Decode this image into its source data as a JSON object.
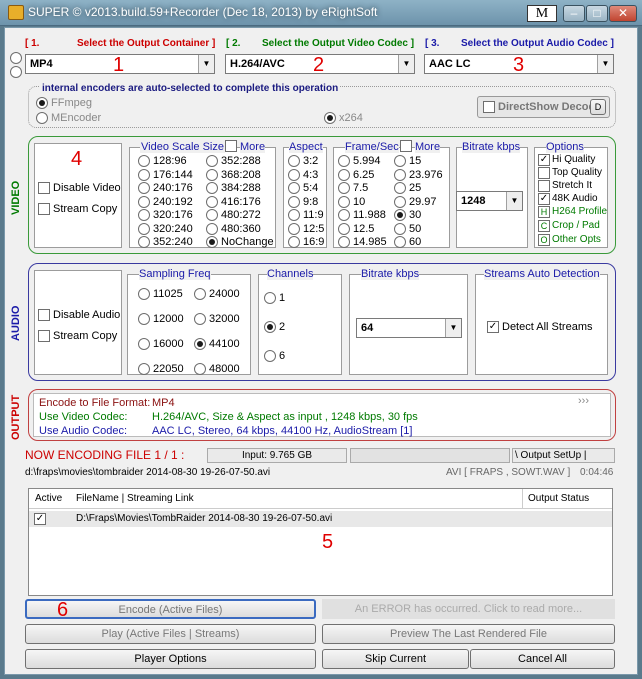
{
  "window": {
    "title": "SUPER © v2013.build.59+Recorder (Dec 18, 2013) by eRightSoft",
    "mode_button": "M",
    "min": "–",
    "max": "□",
    "close": "✕"
  },
  "output": {
    "step1": "[ 1.",
    "step1_label": "Select the Output Container ]",
    "step2": "[ 2.",
    "step2_label": "Select the Output Video Codec ]",
    "step3": "[ 3.",
    "step3_label": "Select the Output Audio Codec ]",
    "container": "MP4",
    "video_codec": "H.264/AVC",
    "audio_codec": "AAC LC",
    "n1": "1",
    "n2": "2",
    "n3": "3"
  },
  "encoders": {
    "title": "internal encoders are auto-selected to complete this operation",
    "ffmpeg": "FFmpeg",
    "mencoder": "MEncoder",
    "x264": "x264",
    "directshow": "DirectShow Decode",
    "d_btn": "D"
  },
  "video": {
    "label": "VIDEO",
    "n4": "4",
    "disable": "Disable Video",
    "stream_copy": "Stream Copy",
    "scale_title": "Video Scale Size",
    "more": "More",
    "scale_col1": [
      "128:96",
      "176:144",
      "240:176",
      "240:192",
      "320:176",
      "320:240",
      "352:240"
    ],
    "scale_col2": [
      "352:288",
      "368:208",
      "384:288",
      "416:176",
      "480:272",
      "480:360",
      "NoChange"
    ],
    "aspect_title": "Aspect",
    "aspects": [
      "3:2",
      "4:3",
      "5:4",
      "9:8",
      "11:9",
      "12:5",
      "16:9"
    ],
    "fps_title": "Frame/Sec",
    "fps_more": "More",
    "fps_col1": [
      "5.994",
      "6.25",
      "7.5",
      "10",
      "11.988",
      "12.5",
      "14.985"
    ],
    "fps_col2": [
      "15",
      "23.976",
      "25",
      "29.97",
      "30",
      "50",
      "60"
    ],
    "bitrate_title": "Bitrate  kbps",
    "bitrate": "1248",
    "options_title": "Options",
    "opt_hq": "Hi Quality",
    "opt_tq": "Top Quality",
    "opt_stretch": "Stretch It",
    "opt_48k": "48K Audio",
    "opt_h264": "H264 Profile",
    "opt_crop": "Crop / Pad",
    "opt_other": "Other Opts",
    "k_h": "H",
    "k_c": "C",
    "k_o": "O"
  },
  "audio": {
    "label": "AUDIO",
    "disable": "Disable Audio",
    "stream_copy": "Stream Copy",
    "freq_title": "Sampling Freq",
    "freq_col1": [
      "11025",
      "12000",
      "16000",
      "22050"
    ],
    "freq_col2": [
      "24000",
      "32000",
      "44100",
      "48000"
    ],
    "ch_title": "Channels",
    "channels": [
      "1",
      "2",
      "6"
    ],
    "bitrate_title": "Bitrate  kbps",
    "bitrate": "64",
    "detect_title": "Streams Auto Detection",
    "detect_all": "Detect All Streams"
  },
  "summary": {
    "label": "OUTPUT",
    "line1_k": "Encode to File Format:",
    "line1_v": "MP4",
    "line2_k": "Use Video Codec:",
    "line2_v": "H.264/AVC,  Size & Aspect as input ,  1248 kbps,  30 fps",
    "line3_k": "Use Audio Codec:",
    "line3_v": "AAC LC,  Stereo,  64 kbps,  44100 Hz,  AudioStream [1]",
    "arrows": "›››"
  },
  "status": {
    "now": "NOW ENCODING FILE 1 / 1 :",
    "input": "Input: 9.765 GB",
    "setup": "\\  Output SetUp  |",
    "filepath": "d:\\fraps\\movies\\tombraider 2014-08-30 19-26-07-50.avi",
    "fileinfo": "AVI [ FRAPS  , SOWT.WAV ]",
    "time": "0:04:46"
  },
  "table": {
    "col_active": "Active",
    "col_file": "FileName  |  Streaming Link",
    "col_status": "Output Status",
    "rows": [
      {
        "file": "D:\\Fraps\\Movies\\TombRaider 2014-08-30 19-26-07-50.avi"
      }
    ],
    "n5": "5"
  },
  "actions": {
    "encode": "Encode (Active Files)",
    "n6": "6",
    "error": "An ERROR has occurred. Click to read more...",
    "play": "Play (Active Files | Streams)",
    "preview": "Preview The Last Rendered File",
    "player_options": "Player Options",
    "skip": "Skip Current",
    "cancel": "Cancel All"
  },
  "colors": {
    "video_border": "#3a9a3a",
    "audio_border": "#3a3aa0",
    "output_border": "#c04040"
  }
}
